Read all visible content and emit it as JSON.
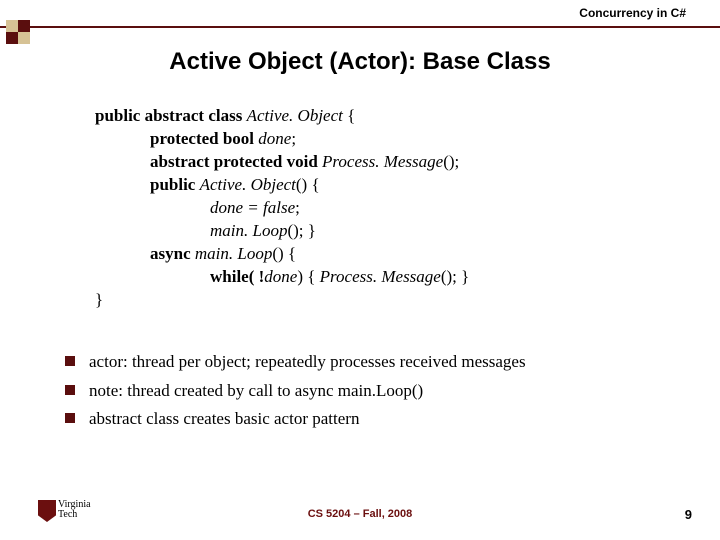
{
  "header": {
    "course_topic": "Concurrency in C#"
  },
  "title": "Active Object (Actor): Base Class",
  "code": {
    "l1a": "public abstract class ",
    "l1b": "Active. Object",
    "l1c": " {",
    "l2a": "protected bool ",
    "l2b": "done",
    "l2c": ";",
    "l3a": "abstract protected void ",
    "l3b": "Process. Message",
    "l3c": "();",
    "l4a": "public ",
    "l4b": "Active. Object",
    "l4c": "() {",
    "l5a": "done = false",
    "l5b": ";",
    "l6a": "main. Loop",
    "l6b": "(); }",
    "l7a": "async ",
    "l7b": "main. Loop",
    "l7c": "() {",
    "l8a": "while( !",
    "l8b": "done",
    "l8c": ") { ",
    "l8d": "Process. Message",
    "l8e": "(); }",
    "l9": "}"
  },
  "bullets": {
    "b1": "actor: thread per object; repeatedly processes received messages",
    "b2": "note: thread created by call to async main.Loop()",
    "b3": "abstract class creates basic actor pattern"
  },
  "footer": {
    "logo_line1": "Virginia",
    "logo_line2": "Tech",
    "course": "CS 5204 – Fall, 2008",
    "page": "9"
  }
}
